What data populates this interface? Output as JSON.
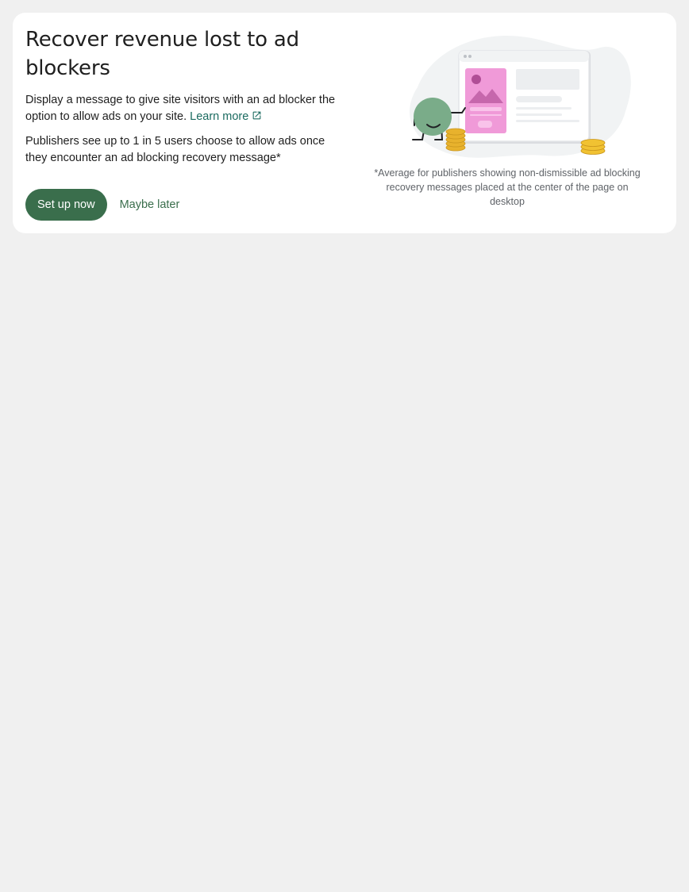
{
  "card": {
    "title": "Recover revenue lost to ad blockers",
    "description": "Display a message to give site visitors with an ad blocker the option to allow ads on your site.",
    "learn_more": "Learn more",
    "stat": "Publishers see up to 1 in 5 users choose to allow ads once they encounter an ad blocking recovery message*",
    "primary_button": "Set up now",
    "secondary_button": "Maybe later",
    "footnote": "*Average for publishers showing non-dismissible ad blocking recovery messages placed at the center of the page on desktop"
  },
  "icons": [
    "external-link-icon",
    "ad-recovery-illustration"
  ],
  "colors": {
    "background": "#f0f0f0",
    "card": "#ffffff",
    "primary": "#3a6e4c",
    "link": "#1b6b60",
    "illustration_pink": "#f09ad8",
    "illustration_green": "#7aac89",
    "illustration_gold": "#f1c232"
  }
}
